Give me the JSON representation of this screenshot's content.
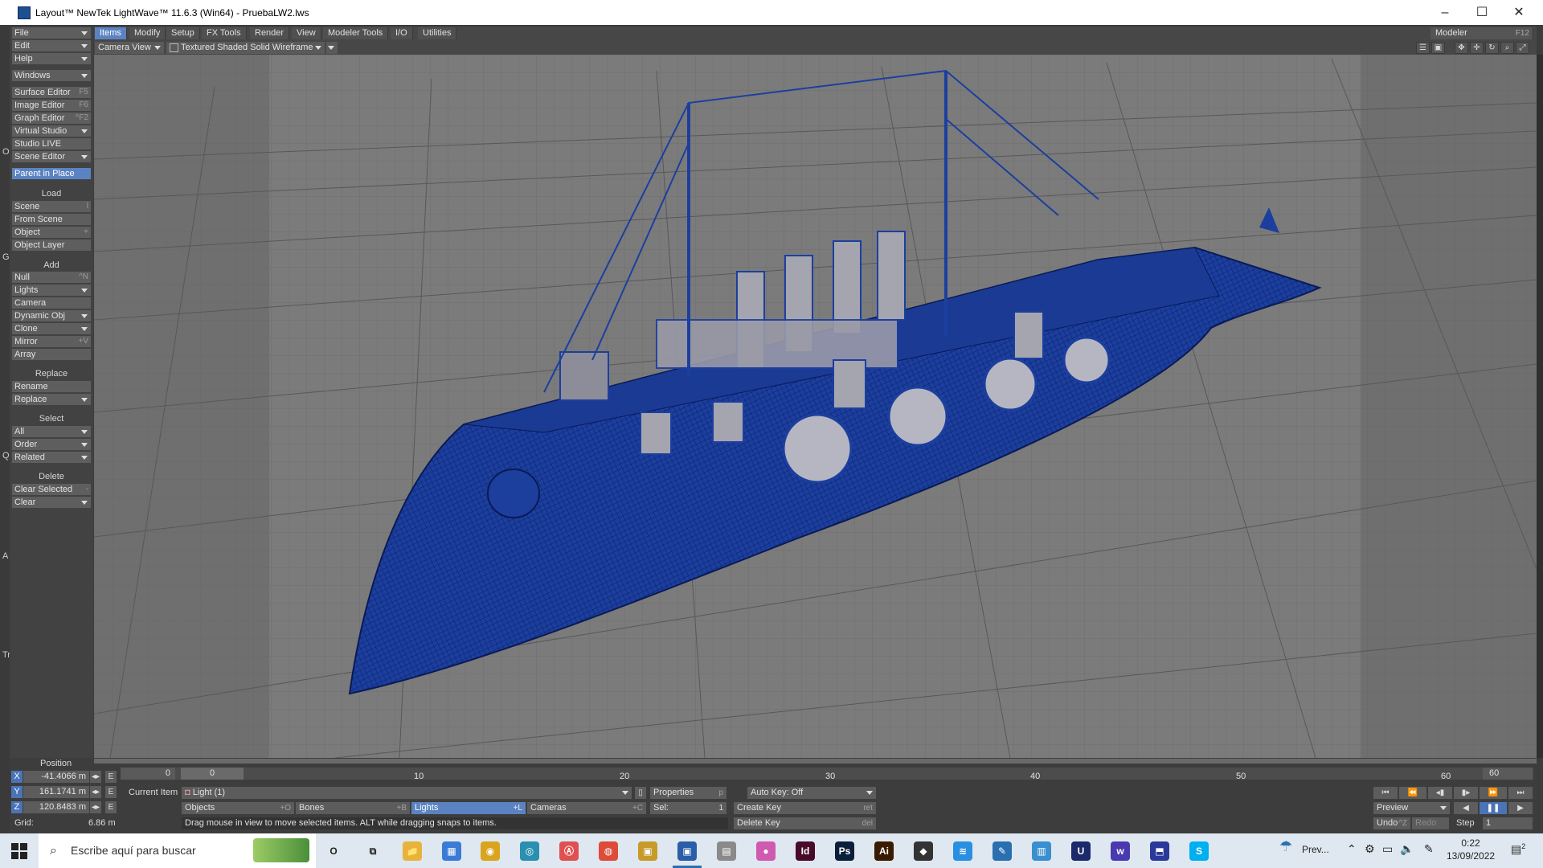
{
  "window": {
    "title": "Layout™ NewTek LightWave™ 11.6.3 (Win64) - PruebaLW2.lws",
    "min_label": "–",
    "max_label": "☐",
    "close_label": "✕"
  },
  "left_panel": {
    "top_buttons": [
      {
        "label": "File",
        "shortcut": ""
      },
      {
        "label": "Edit",
        "shortcut": ""
      },
      {
        "label": "Help",
        "shortcut": ""
      }
    ],
    "windows_label": "Windows",
    "editors": [
      {
        "label": "Surface Editor",
        "shortcut": "F5"
      },
      {
        "label": "Image Editor",
        "shortcut": "F6"
      },
      {
        "label": "Graph Editor",
        "shortcut": "^F2"
      },
      {
        "label": "Virtual Studio",
        "shortcut": ""
      },
      {
        "label": "Studio LIVE",
        "shortcut": ""
      },
      {
        "label": "Scene Editor",
        "shortcut": ""
      }
    ],
    "parent_in_place": "Parent in Place",
    "load_header": "Load",
    "load_items": [
      {
        "label": "Scene",
        "shortcut": "l"
      },
      {
        "label": "From Scene",
        "shortcut": ""
      },
      {
        "label": "Object",
        "shortcut": "+"
      },
      {
        "label": "Object Layer",
        "shortcut": ""
      }
    ],
    "add_header": "Add",
    "add_items": [
      {
        "label": "Null",
        "shortcut": "^N"
      },
      {
        "label": "Lights",
        "shortcut": ""
      },
      {
        "label": "Camera",
        "shortcut": ""
      },
      {
        "label": "Dynamic Obj",
        "shortcut": ""
      },
      {
        "label": "Clone",
        "shortcut": ""
      },
      {
        "label": "Mirror",
        "shortcut": "+V"
      },
      {
        "label": "Array",
        "shortcut": ""
      }
    ],
    "replace_header": "Replace",
    "replace_items": [
      {
        "label": "Rename",
        "shortcut": ""
      },
      {
        "label": "Replace",
        "shortcut": ""
      }
    ],
    "select_header": "Select",
    "select_items": [
      {
        "label": "All",
        "shortcut": ""
      },
      {
        "label": "Order",
        "shortcut": ""
      },
      {
        "label": "Related",
        "shortcut": ""
      }
    ],
    "delete_header": "Delete",
    "delete_items": [
      {
        "label": "Clear Selected",
        "shortcut": "-"
      },
      {
        "label": "Clear",
        "shortcut": ""
      }
    ],
    "edge_marks": [
      "O",
      "G",
      "Q",
      "A",
      "Tr"
    ]
  },
  "menu_tabs": [
    "Items",
    "Modify",
    "Setup",
    "FX Tools",
    "Render",
    "View",
    "Modeler Tools",
    "I/O",
    "Utilities"
  ],
  "modeler_button": {
    "label": "Modeler",
    "shortcut": "F12"
  },
  "view_bar": {
    "camera_view": "Camera View",
    "render_mode": "Textured Shaded Solid Wireframe"
  },
  "bottom": {
    "position_label": "Position",
    "x_value": "-41.4066 m",
    "y_value": "161.1741 m",
    "z_value": "120.8483 m",
    "grid_label": "Grid:",
    "grid_value": "6.86 m",
    "current_item_label": "Current Item",
    "current_item_value": "Light (1)",
    "properties_label": "Properties",
    "properties_shortcut": "p",
    "auto_key_label": "Auto Key: Off",
    "objects_label": "Objects",
    "objects_shortcut": "+O",
    "bones_label": "Bones",
    "bones_shortcut": "+B",
    "lights_label": "Lights",
    "lights_shortcut": "+L",
    "cameras_label": "Cameras",
    "cameras_shortcut": "+C",
    "sel_label": "Sel:",
    "sel_value": "1",
    "create_key_label": "Create Key",
    "create_key_shortcut": "ret",
    "delete_key_label": "Delete Key",
    "delete_key_shortcut": "del",
    "status_text": "Drag mouse in view to move selected items. ALT while dragging snaps to items.",
    "preview_label": "Preview",
    "undo_label": "Undo",
    "undo_shortcut": "^Z",
    "redo_label": "Redo",
    "step_label": "Step",
    "step_value": "1",
    "timeline_start": "0",
    "timeline_current": "0",
    "timeline_ticks": [
      "10",
      "20",
      "30",
      "40",
      "50",
      "60"
    ],
    "timeline_end": "60"
  },
  "taskbar": {
    "search_placeholder": "Escribe aquí para buscar",
    "tray_preview_label": "Prev...",
    "time": "0:22",
    "date": "13/09/2022",
    "notification_count": "2",
    "app_icons": [
      {
        "name": "cortana",
        "label": "O",
        "color": "#dfe8f0"
      },
      {
        "name": "task-view",
        "label": "⧉",
        "color": "#dfe8f0"
      },
      {
        "name": "file-explorer",
        "label": "📁",
        "color": "#e8b33a"
      },
      {
        "name": "calculator",
        "label": "▦",
        "color": "#3a7bd5"
      },
      {
        "name": "app-yellow",
        "label": "◉",
        "color": "#d9a520"
      },
      {
        "name": "app-teal",
        "label": "◎",
        "color": "#2a8fb0"
      },
      {
        "name": "app-red-outline",
        "label": "Ⓐ",
        "color": "#e05050"
      },
      {
        "name": "chrome",
        "label": "◍",
        "color": "#dd4b39"
      },
      {
        "name": "app-gold",
        "label": "▣",
        "color": "#c79a2a"
      },
      {
        "name": "lightwave-layout",
        "label": "▣",
        "color": "#2a5ea8"
      },
      {
        "name": "app-grey",
        "label": "▤",
        "color": "#8a8a8a"
      },
      {
        "name": "app-gradient",
        "label": "●",
        "color": "#d05ab0"
      },
      {
        "name": "indesign",
        "label": "Id",
        "color": "#4a0a2a"
      },
      {
        "name": "photoshop",
        "label": "Ps",
        "color": "#0a1f3a"
      },
      {
        "name": "illustrator",
        "label": "Ai",
        "color": "#3a1a00"
      },
      {
        "name": "app-dark",
        "label": "◆",
        "color": "#333333"
      },
      {
        "name": "app-blue-wave",
        "label": "≋",
        "color": "#2a8fe0"
      },
      {
        "name": "app-pen",
        "label": "✎",
        "color": "#2a6fb0"
      },
      {
        "name": "app-monitor",
        "label": "▥",
        "color": "#3a8fd0"
      },
      {
        "name": "app-u",
        "label": "U",
        "color": "#1a2a6a"
      },
      {
        "name": "app-w",
        "label": "w",
        "color": "#4a3ab0"
      },
      {
        "name": "app-folder-blue",
        "label": "⬒",
        "color": "#2a3a9a"
      },
      {
        "name": "skype",
        "label": "S",
        "color": "#00aff0"
      }
    ]
  }
}
